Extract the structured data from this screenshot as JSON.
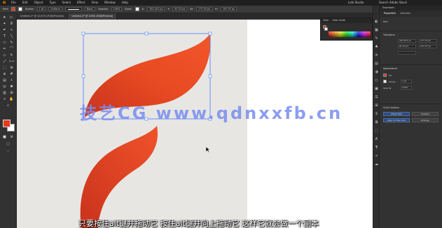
{
  "app": {
    "logo": "Ai",
    "menu": [
      "File",
      "Edit",
      "Object",
      "Type",
      "Select",
      "Effect",
      "View",
      "Window",
      "Help"
    ],
    "workspace": "Lofo Studio",
    "search_label": "Search Adobe Stock"
  },
  "control_bar": {
    "selection_label": "Path",
    "stroke_label": "Stroke:",
    "stroke_value": "1 pt",
    "uniform_label": "Uniform",
    "basic_label": "Basic",
    "opacity_label": "Opacity:",
    "opacity_value": "100%",
    "style_label": "Style:",
    "x_label": "X:",
    "x_value": "352.421 px",
    "y_label": "Y:",
    "y_value": "87.23 px",
    "w_label": "W:",
    "w_value": "177.33 px",
    "h_label": "H:",
    "h_value": "107.37 px",
    "colors": {
      "fill": "#e63a1a",
      "stroke": "#ffffff"
    }
  },
  "tabs": [
    {
      "label": "Untitled-1* @ 41.67% (RGB/Preview)",
      "active": false
    },
    {
      "label": "Untitled-2* @ 100% (RGB/Preview)",
      "active": true
    }
  ],
  "color_panel": {
    "tabs": [
      "Color",
      "Color Guide"
    ],
    "colors": {
      "fill": "#e63a1a",
      "stroke": "#ffffff"
    }
  },
  "right_panel": {
    "top_label": "Essentials",
    "tabs": [
      {
        "label": "Properties",
        "active": true
      },
      {
        "label": "Libraries",
        "active": false
      }
    ],
    "path_label": "Path",
    "transform_heading": "Transform",
    "x_value": "352.421 px",
    "y_value": "87.23 px",
    "w_value": "177.33 px",
    "h_value": "107.37 px",
    "appearance_heading": "Appearance",
    "fill_label": "Fill",
    "stroke_label": "Stroke",
    "stroke_value": "1 pt",
    "opacity_label": "Opacity",
    "opacity_value": "100%",
    "quick_actions_heading": "Quick Actions",
    "offset_path": "Offset Path",
    "simplify": "Simplify",
    "align_pixel_grid": "Align to Pixel Grid",
    "arrange": "Arrange",
    "colors": {
      "fill": "#e63a1a",
      "accent": "#2f4a7a"
    }
  },
  "icons": {
    "toolbar": [
      "selection-icon",
      "direct-selection-icon",
      "magic-wand-icon",
      "lasso-icon",
      "pen-icon",
      "curvature-icon",
      "type-icon",
      "line-icon",
      "rectangle-icon",
      "paintbrush-icon",
      "pencil-icon",
      "shaper-icon",
      "eraser-icon",
      "rotate-icon",
      "scale-icon",
      "width-icon",
      "free-transform-icon",
      "shape-builder-icon",
      "perspective-icon",
      "mesh-icon",
      "gradient-icon",
      "eyedropper-icon",
      "blend-icon",
      "symbol-sprayer-icon",
      "graph-icon",
      "artboard-icon",
      "slice-icon",
      "hand-icon",
      "zoom-icon"
    ]
  },
  "overlay": {
    "watermark": "技艺CG www.qdnxxfb.cn",
    "subtitle": "只要按住alt键并拖动它 按住alt键并向上拖动它 这样它就会做一个副本"
  }
}
